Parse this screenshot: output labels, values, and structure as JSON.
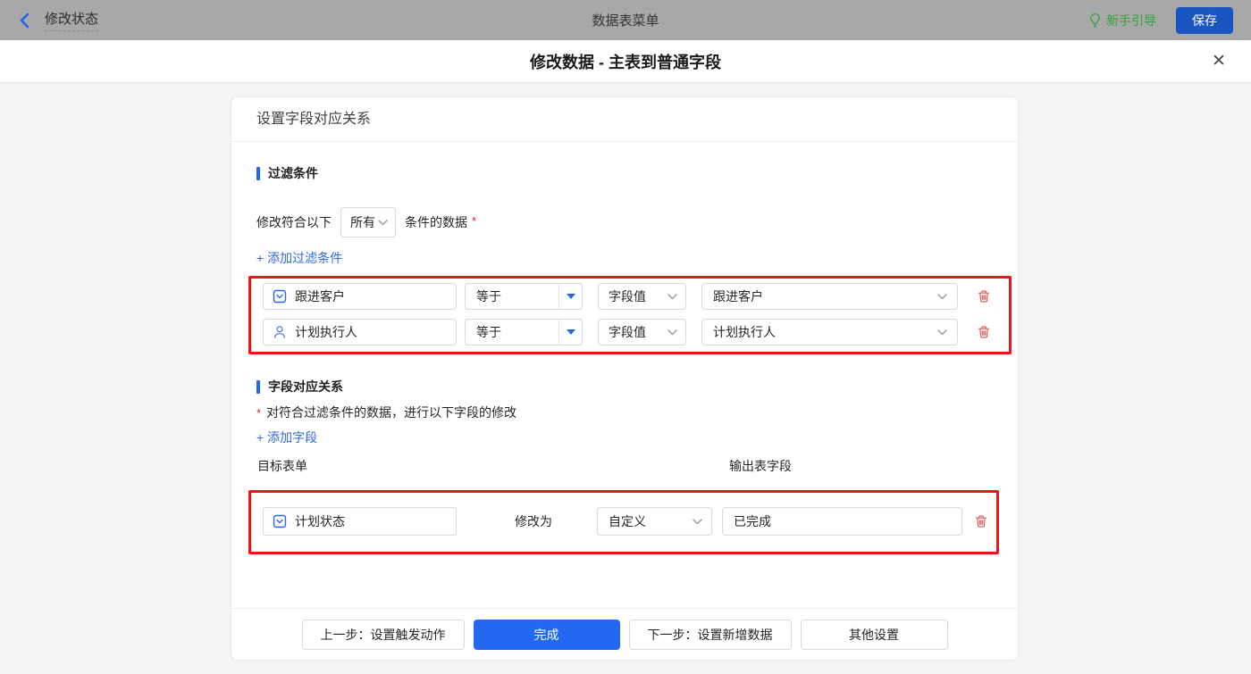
{
  "topbar": {
    "back_label": "修改状态",
    "center_title": "数据表菜单",
    "guide_label": "新手引导",
    "save_label": "保存"
  },
  "modal": {
    "title": "修改数据 - 主表到普通字段",
    "close_glyph": "✕"
  },
  "card": {
    "header": "设置字段对应关系",
    "filter_section": {
      "title": "过滤条件",
      "match_prefix": "修改符合以下",
      "match_select_value": "所有",
      "match_suffix": "条件的数据",
      "required_mark": "*",
      "add_link": "+ 添加过滤条件",
      "rows": [
        {
          "field": "跟进客户",
          "field_icon": "select-field-icon",
          "operator": "等于",
          "value_type": "字段值",
          "value": "跟进客户"
        },
        {
          "field": "计划执行人",
          "field_icon": "user-icon",
          "operator": "等于",
          "value_type": "字段值",
          "value": "计划执行人"
        }
      ]
    },
    "mapping_section": {
      "title": "字段对应关系",
      "required_mark": "*",
      "description": "对符合过滤条件的数据，进行以下字段的修改",
      "add_link": "+ 添加字段",
      "column_left": "目标表单",
      "column_right": "输出表字段",
      "rows": [
        {
          "field": "计划状态",
          "field_icon": "select-field-icon",
          "action_label": "修改为",
          "mode": "自定义",
          "value": "已完成"
        }
      ]
    },
    "footer": {
      "prev_label": "上一步：设置触发动作",
      "done_label": "完成",
      "next_label": "下一步：设置新增数据",
      "other_label": "其他设置"
    }
  },
  "colors": {
    "accent_blue": "#2468f2",
    "link_blue": "#2d6ae3",
    "save_blue": "#1a56c2",
    "guide_green": "#35a23a",
    "highlight_red": "#f01414",
    "danger_red": "#e65a5a",
    "topbar_gray": "#a8a8a8"
  }
}
